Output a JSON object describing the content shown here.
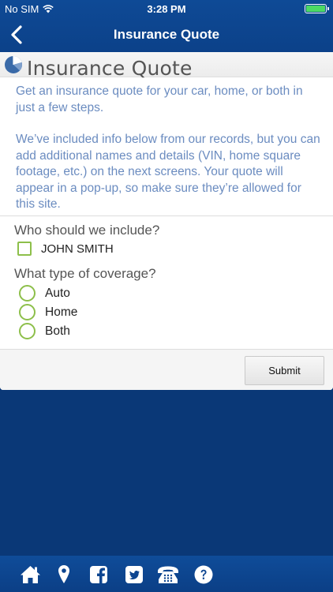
{
  "status_bar": {
    "carrier": "No SIM",
    "time": "3:28 PM",
    "battery_level": 1.0,
    "battery_color": "#4cd964"
  },
  "nav": {
    "title": "Insurance Quote",
    "back_icon": "chevron-left-icon"
  },
  "card": {
    "header_title": "Insurance Quote",
    "header_icon": "pie-chart-icon",
    "intro_paragraphs": [
      "Get an insurance quote for your car, home, or both in just a few steps.",
      "We’ve included info below from our records, but you can add additional names and details (VIN, home square footage, etc.) on the next screens. Your quote will appear in a pop-up, so make sure they’re allowed for this site."
    ],
    "include_question": "Who should we include?",
    "people": [
      {
        "label": "JOHN SMITH",
        "checked": false
      }
    ],
    "coverage_question": "What type of coverage?",
    "coverage_options": [
      {
        "label": "Auto",
        "selected": false
      },
      {
        "label": "Home",
        "selected": false
      },
      {
        "label": "Both",
        "selected": false
      }
    ],
    "submit_label": "Submit"
  },
  "toolbar": {
    "icons": [
      "home-icon",
      "location-pin-icon",
      "facebook-icon",
      "twitter-icon",
      "phone-icon",
      "help-icon"
    ]
  },
  "colors": {
    "brand_blue": "#0c4189",
    "accent_green": "#8dbf4a",
    "intro_text": "#6b8cc0"
  }
}
